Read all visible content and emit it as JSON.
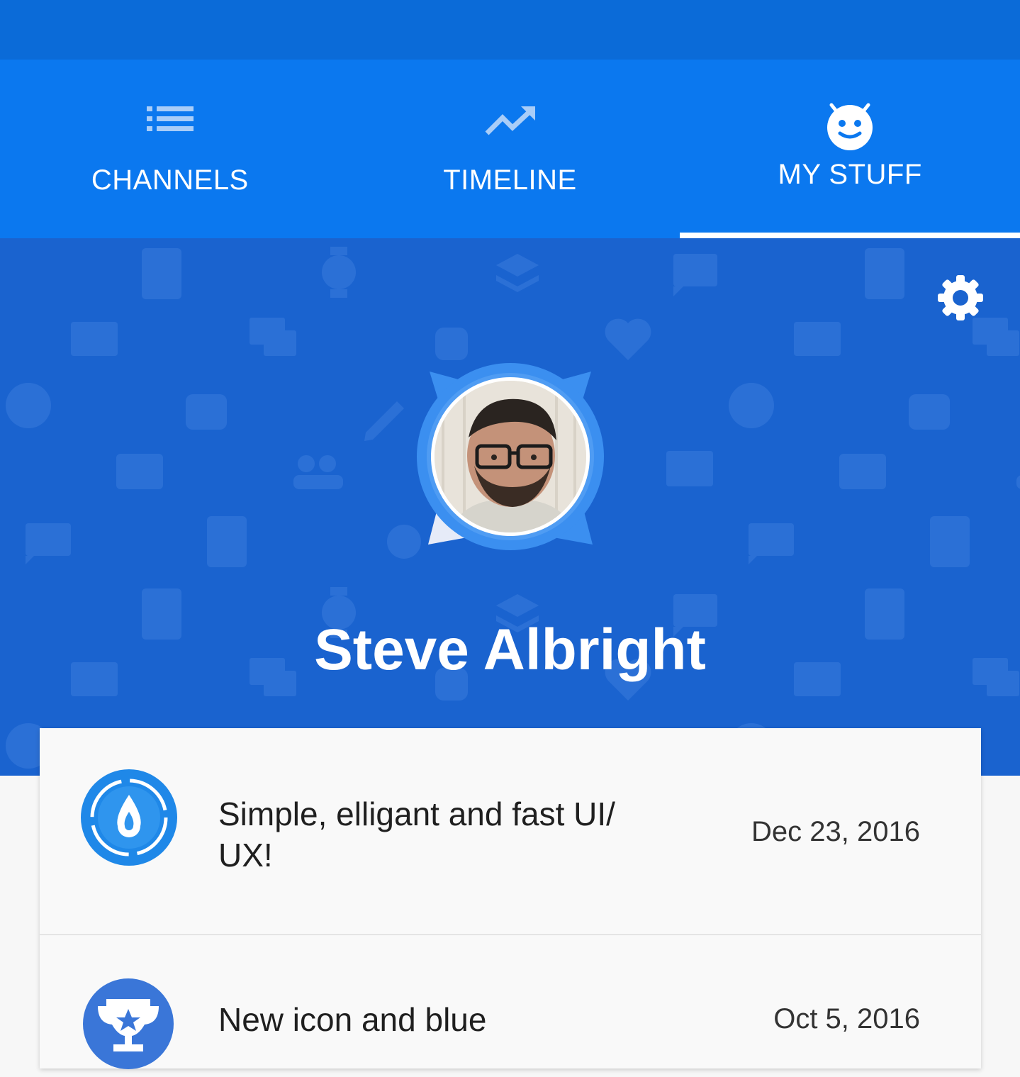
{
  "colors": {
    "status_bar": "#0b6bd8",
    "tab_bar": "#0b78ef",
    "hero": "#1a63cf",
    "card": "#f9f9f9"
  },
  "tabs": [
    {
      "label": "CHANNELS",
      "icon": "list-icon",
      "active": false
    },
    {
      "label": "TIMELINE",
      "icon": "trending-up-icon",
      "active": false
    },
    {
      "label": "MY STUFF",
      "icon": "android-face-icon",
      "active": true
    }
  ],
  "profile": {
    "name": "Steve Albright",
    "avatar_icon": "user-photo"
  },
  "settings": {
    "icon": "gear-icon"
  },
  "items": [
    {
      "icon": "water-drop-badge-icon",
      "title": "Simple, elligant and fast UI/ UX!",
      "date": "Dec 23, 2016"
    },
    {
      "icon": "trophy-badge-icon",
      "title": "New icon and blue",
      "date": "Oct 5, 2016"
    }
  ]
}
